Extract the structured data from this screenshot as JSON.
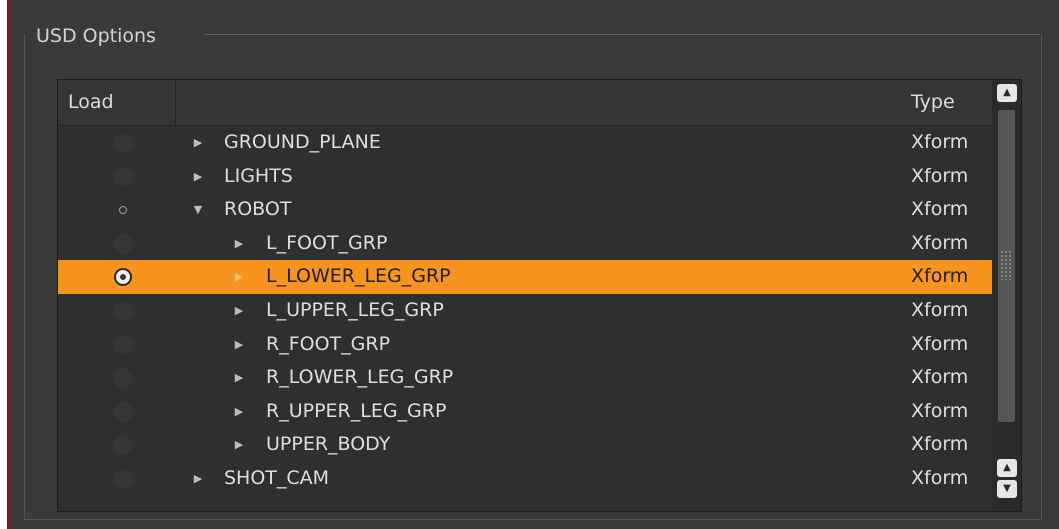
{
  "panel": {
    "title": "USD Options"
  },
  "tree": {
    "columns": {
      "load": "Load",
      "type": "Type"
    },
    "rows": [
      {
        "name": "GROUND_PLANE",
        "type": "Xform",
        "expanded": false,
        "load_state": "empty"
      },
      {
        "name": "LIGHTS",
        "type": "Xform",
        "expanded": false,
        "load_state": "empty"
      },
      {
        "name": "ROBOT",
        "type": "Xform",
        "expanded": true,
        "load_state": "partial"
      },
      {
        "name": "L_FOOT_GRP",
        "type": "Xform",
        "expanded": false,
        "load_state": "empty"
      },
      {
        "name": "L_LOWER_LEG_GRP",
        "type": "Xform",
        "expanded": false,
        "load_state": "loaded",
        "selected": true
      },
      {
        "name": "L_UPPER_LEG_GRP",
        "type": "Xform",
        "expanded": false,
        "load_state": "empty"
      },
      {
        "name": "R_FOOT_GRP",
        "type": "Xform",
        "expanded": false,
        "load_state": "empty"
      },
      {
        "name": "R_LOWER_LEG_GRP",
        "type": "Xform",
        "expanded": false,
        "load_state": "empty"
      },
      {
        "name": "R_UPPER_LEG_GRP",
        "type": "Xform",
        "expanded": false,
        "load_state": "empty"
      },
      {
        "name": "UPPER_BODY",
        "type": "Xform",
        "expanded": false,
        "load_state": "empty"
      },
      {
        "name": "SHOT_CAM",
        "type": "Xform",
        "expanded": false,
        "load_state": "empty"
      }
    ]
  },
  "icons": {
    "collapsed": "caret-right-icon",
    "expanded": "caret-down-icon",
    "scroll_up": "scroll-up-arrow-icon",
    "scroll_down": "scroll-down-arrow-icon"
  },
  "colors": {
    "selection": "#f7941d",
    "panel_bg": "#3a3a3a",
    "tree_bg": "#2f2f2f",
    "accent_edge": "#7a1f1f"
  }
}
